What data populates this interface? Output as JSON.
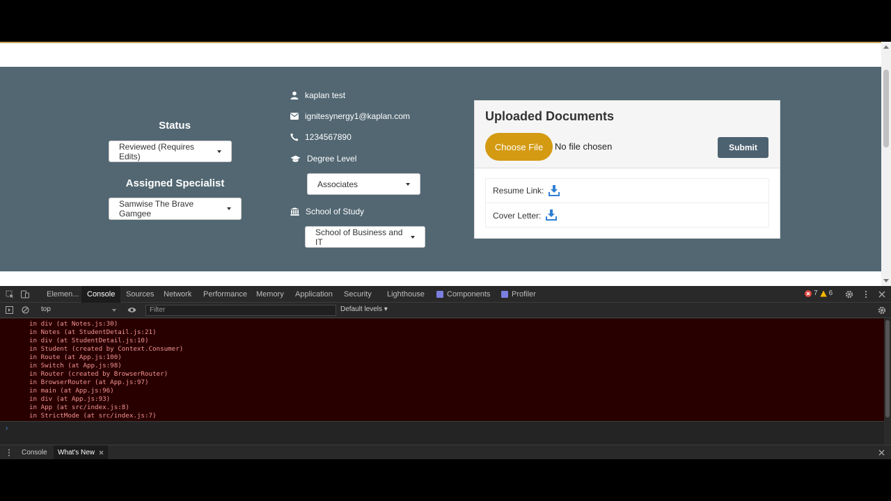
{
  "status": {
    "heading": "Status",
    "selected": "Reviewed (Requires Edits)"
  },
  "specialist": {
    "heading": "Assigned Specialist",
    "selected": "Samwise The Brave Gamgee"
  },
  "student": {
    "name": "kaplan test",
    "email": "ignitesynergy1@kaplan.com",
    "phone": "1234567890",
    "degree_label": "Degree Level",
    "degree_selected": "Associates",
    "school_label": "School of Study",
    "school_selected": "School of Business and IT"
  },
  "documents": {
    "title": "Uploaded Documents",
    "choose_label": "Choose File",
    "no_file": "No file chosen",
    "submit_label": "Submit",
    "resume_label": "Resume Link:",
    "cover_label": "Cover Letter:"
  },
  "devtools": {
    "tabs": [
      "Elemen...",
      "Console",
      "Sources",
      "Network",
      "Performance",
      "Memory",
      "Application",
      "Security",
      "Lighthouse",
      "Components",
      "Profiler"
    ],
    "errors": "7",
    "warnings": "6",
    "context": "top",
    "filter_placeholder": "Filter",
    "levels": "Default levels ▾",
    "console_lines": [
      "in div (at Notes.js:30)",
      "in Notes (at StudentDetail.js:21)",
      "in div (at StudentDetail.js:10)",
      "in Student (created by Context.Consumer)",
      "in Route (at App.js:100)",
      "in Switch (at App.js:98)",
      "in Router (created by BrowserRouter)",
      "in BrowserRouter (at App.js:97)",
      "in main (at App.js:96)",
      "in div (at App.js:93)",
      "in App (at src/index.js:8)",
      "in StrictMode (at src/index.js:7)"
    ],
    "drawer_tabs": [
      "Console",
      "What's New"
    ]
  },
  "colors": {
    "panel": "#526772",
    "accent_gold": "#d39a12",
    "submit": "#4d6270",
    "download_icon": "#2f80d4",
    "console_error_bg": "#290000"
  }
}
